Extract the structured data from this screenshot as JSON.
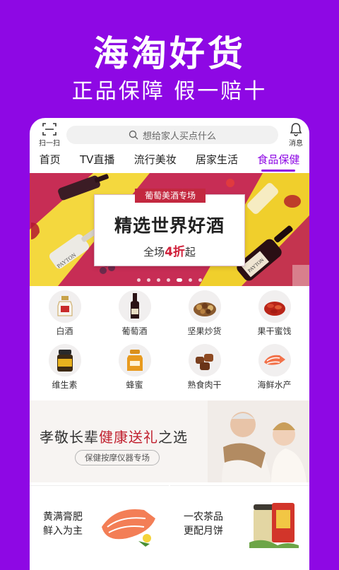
{
  "promo": {
    "title": "海淘好货",
    "subtitle": "正品保障 假一赔十"
  },
  "header": {
    "scan_label": "扫一扫",
    "search_placeholder": "想给家人买点什么",
    "message_label": "消息"
  },
  "nav": {
    "tabs": [
      {
        "label": "首页",
        "active": false
      },
      {
        "label": "TV直播",
        "active": false
      },
      {
        "label": "流行美妆",
        "active": false
      },
      {
        "label": "居家生活",
        "active": false
      },
      {
        "label": "食品保健",
        "active": true
      }
    ]
  },
  "banner": {
    "tag": "葡萄美酒专场",
    "headline": "精选世界好酒",
    "promo_prefix": "全场",
    "promo_highlight": "4折",
    "promo_suffix": "起",
    "label_left": "PAYTON",
    "label_right": "PAYTON",
    "slide_count": 7,
    "active_slide": 5
  },
  "categories": {
    "row1": [
      {
        "label": "白酒",
        "icon": "baijiu-icon"
      },
      {
        "label": "葡萄酒",
        "icon": "wine-icon"
      },
      {
        "label": "坚果炒货",
        "icon": "nuts-icon"
      },
      {
        "label": "果干蜜饯",
        "icon": "dried-fruit-icon"
      }
    ],
    "row2": [
      {
        "label": "维生素",
        "icon": "vitamin-icon"
      },
      {
        "label": "蜂蜜",
        "icon": "honey-icon"
      },
      {
        "label": "熟食肉干",
        "icon": "jerky-icon"
      },
      {
        "label": "海鲜水产",
        "icon": "seafood-icon"
      }
    ]
  },
  "health_banner": {
    "title_prefix": "孝敬长辈",
    "title_highlight": "健康送礼",
    "title_suffix": "之选",
    "button": "保健按摩仪器专场"
  },
  "cards": [
    {
      "line1": "黄满膏肥",
      "line2": "鲜入为主"
    },
    {
      "line1": "一农茶品",
      "line2": "更配月饼"
    }
  ],
  "colors": {
    "brand_purple": "#8e08e4",
    "accent_red": "#c3283f"
  }
}
